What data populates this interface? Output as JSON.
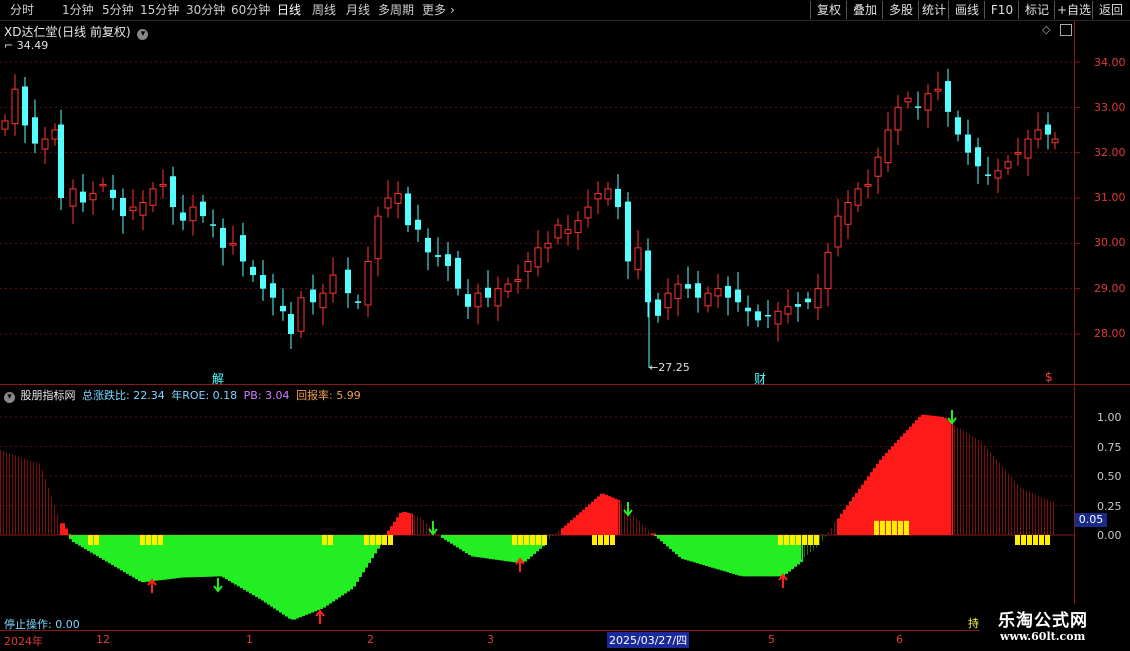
{
  "toolbar": {
    "periods": [
      "分时",
      "1分钟",
      "5分钟",
      "15分钟",
      "30分钟",
      "60分钟",
      "日线",
      "周线",
      "月线",
      "多周期",
      "更多"
    ],
    "active": "日线",
    "more_icon": "chevron-right-icon",
    "right_buttons": [
      "复权",
      "叠加",
      "多股",
      "统计",
      "画线",
      "F10",
      "标记",
      "+自选",
      "返回"
    ]
  },
  "main_chart": {
    "title": "XD达仁堂(日线 前复权)",
    "high_label": "34.49",
    "low_label": "27.25",
    "markers": [
      "解",
      "财",
      "$"
    ],
    "price_axis": [
      "34.00",
      "33.00",
      "32.00",
      "31.00",
      "30.00",
      "29.00",
      "28.00"
    ],
    "price_range": [
      27.25,
      34.49
    ],
    "up_color": "#ff3333",
    "down_color": "#54ffff"
  },
  "indicator": {
    "name": "股朋指标网",
    "items": [
      {
        "label": "总涨跌比: ",
        "value": "22.34",
        "color": "#7ad7ff"
      },
      {
        "label": "年ROE: ",
        "value": "0.18",
        "color": "#7ad7ff"
      },
      {
        "label": "PB: ",
        "value": "3.04",
        "color": "#d080ff"
      },
      {
        "label": "回报率: ",
        "value": "5.99",
        "color": "#f0a050"
      }
    ],
    "axis": [
      "1.00",
      "0.75",
      "0.50",
      "0.25",
      "0.00"
    ],
    "current_value": "0.05",
    "stop_label": "停止操作: 0.00",
    "right_tag": "持"
  },
  "x_axis": {
    "labels": [
      "2024年",
      "12",
      "1",
      "2",
      "3",
      "2025/03/27/四",
      "5",
      "6"
    ]
  },
  "watermark": {
    "title": "乐淘公式网",
    "url": "www.60lt.com"
  }
}
